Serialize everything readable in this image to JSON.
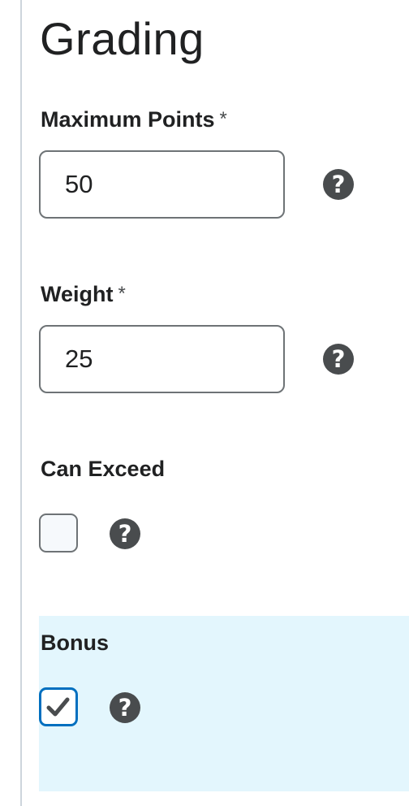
{
  "section": {
    "title": "Grading"
  },
  "fields": {
    "max_points": {
      "label": "Maximum Points",
      "required_mark": "*",
      "value": "50",
      "help_icon": "question-circle-icon"
    },
    "weight": {
      "label": "Weight",
      "required_mark": "*",
      "value": "25",
      "help_icon": "question-circle-icon"
    },
    "can_exceed": {
      "label": "Can Exceed",
      "checked": false,
      "help_icon": "question-circle-icon"
    },
    "bonus": {
      "label": "Bonus",
      "checked": true,
      "help_icon": "question-circle-icon"
    }
  },
  "colors": {
    "text": "#202122",
    "input_border": "#6e7376",
    "icon": "#494c4e",
    "focus_border": "#006fbf",
    "highlight_background": "#e3f6fd",
    "side_rule": "#cdd5dc"
  }
}
